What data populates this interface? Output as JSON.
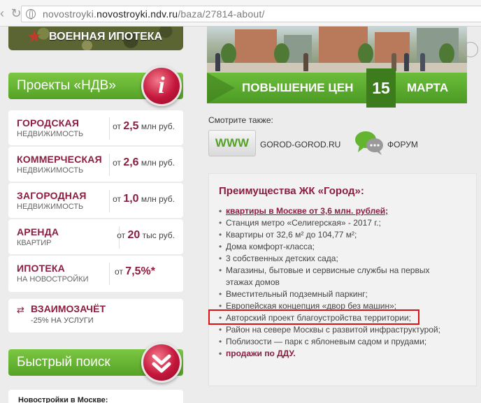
{
  "browser": {
    "url_domain": "novostroyki.ndv.ru",
    "url_path": "/baza/27814-about/",
    "url_prefix": "novostroyki."
  },
  "left": {
    "military_banner": "ВОЕННАЯ ИПОТЕКА",
    "projects_header": "Проекты «НДВ»",
    "projects_badge_glyph": "i",
    "cards": [
      {
        "title": "ГОРОДСКАЯ",
        "subtitle": "НЕДВИЖИМОСТЬ",
        "price_prefix": "от",
        "price_value": "2,5",
        "price_unit": "млн руб."
      },
      {
        "title": "КОММЕРЧЕСКАЯ",
        "subtitle": "НЕДВИЖИМОСТЬ",
        "price_prefix": "от",
        "price_value": "2,6",
        "price_unit": "млн руб."
      },
      {
        "title": "ЗАГОРОДНАЯ",
        "subtitle": "НЕДВИЖИМОСТЬ",
        "price_prefix": "от",
        "price_value": "1,0",
        "price_unit": "млн руб."
      },
      {
        "title": "АРЕНДА",
        "subtitle": "КВАРТИР",
        "price_prefix": "от",
        "price_value": "20",
        "price_unit": "тыс руб."
      },
      {
        "title": "ИПОТЕКА",
        "subtitle": "НА НОВОСТРОЙКИ",
        "price_prefix": "от",
        "price_value": "7,5%*",
        "price_unit": ""
      }
    ],
    "swap": {
      "title": "ВЗАИМОЗАЧЁТ",
      "subtitle": "-25% НА УСЛУГИ"
    },
    "search_header": "Быстрый поиск",
    "novostroyki_label": "Новостройки в Москве:"
  },
  "right": {
    "price_banner": {
      "text": "ПОВЫШЕНИЕ ЦЕН",
      "day": "15",
      "month": "МАРТА"
    },
    "see_also": "Смотрите также:",
    "www_label": "WWW",
    "link1": "GOROD-GOROD.RU",
    "link2": "ФОРУМ",
    "panel": {
      "title": "Преимущества ЖК «Город»:",
      "items": [
        "квартиры в Москве от 3,6 млн. рублей;",
        "Станция метро «Селигерская» - 2017 г.;",
        "Квартиры от 32,6 м² до 104,77 м²;",
        "Дома комфорт-класса;",
        "3 собственных детских сада;",
        "Магазины, бытовые и сервисные службы на первых этажах домов",
        "Вместительный подземный паркинг;",
        "Европейская концепция «двор без машин»;",
        "Авторский проект благоустройства территории;",
        "Район на севере Москвы с развитой инфраструктурой;",
        "Поблизости — парк с яблоневым садом и прудами;",
        "продажи по ДДУ."
      ]
    }
  },
  "colors": {
    "brand_red": "#8b1e3f",
    "brand_green": "#56a227",
    "highlight": "#e01010"
  }
}
